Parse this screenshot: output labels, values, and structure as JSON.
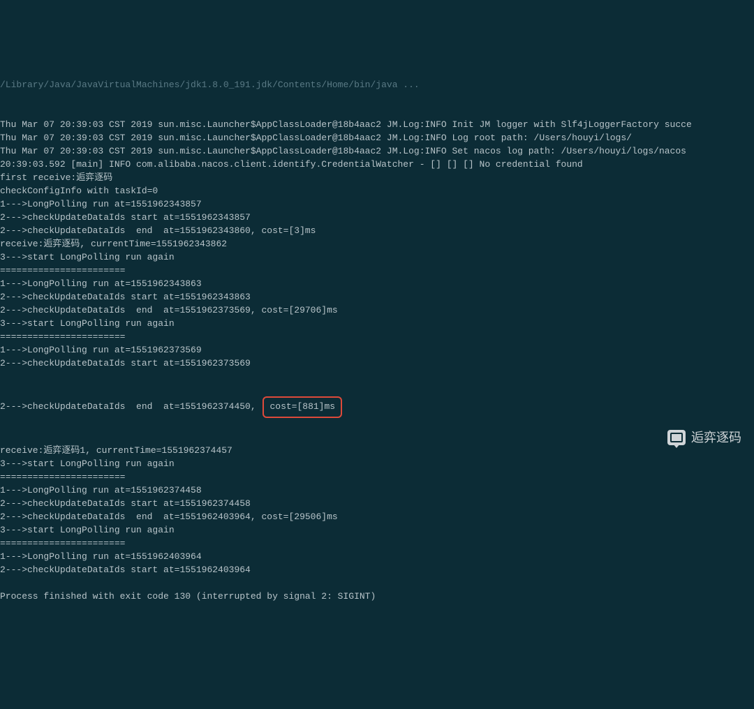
{
  "header": "/Library/Java/JavaVirtualMachines/jdk1.8.0_191.jdk/Contents/Home/bin/java ...",
  "lines": [
    "Thu Mar 07 20:39:03 CST 2019 sun.misc.Launcher$AppClassLoader@18b4aac2 JM.Log:INFO Init JM logger with Slf4jLoggerFactory succe",
    "Thu Mar 07 20:39:03 CST 2019 sun.misc.Launcher$AppClassLoader@18b4aac2 JM.Log:INFO Log root path: /Users/houyi/logs/",
    "Thu Mar 07 20:39:03 CST 2019 sun.misc.Launcher$AppClassLoader@18b4aac2 JM.Log:INFO Set nacos log path: /Users/houyi/logs/nacos",
    "20:39:03.592 [main] INFO com.alibaba.nacos.client.identify.CredentialWatcher - [] [] [] No credential found",
    "first receive:逅弈逐码",
    "checkConfigInfo with taskId=0",
    "1--->LongPolling run at=1551962343857",
    "2--->checkUpdateDataIds start at=1551962343857",
    "2--->checkUpdateDataIds  end  at=1551962343860, cost=[3]ms",
    "receive:逅弈逐码, currentTime=1551962343862",
    "3--->start LongPolling run again",
    "=======================",
    "1--->LongPolling run at=1551962343863",
    "2--->checkUpdateDataIds start at=1551962343863",
    "2--->checkUpdateDataIds  end  at=1551962373569, cost=[29706]ms",
    "3--->start LongPolling run again",
    "=======================",
    "1--->LongPolling run at=1551962373569",
    "2--->checkUpdateDataIds start at=1551962373569"
  ],
  "highlighted": {
    "prefix": "2--->checkUpdateDataIds  end  at=1551962374450, ",
    "boxed": "cost=[881]ms"
  },
  "lines_after": [
    "receive:逅弈逐码1, currentTime=1551962374457",
    "3--->start LongPolling run again",
    "=======================",
    "1--->LongPolling run at=1551962374458",
    "2--->checkUpdateDataIds start at=1551962374458",
    "2--->checkUpdateDataIds  end  at=1551962403964, cost=[29506]ms",
    "3--->start LongPolling run again",
    "=======================",
    "1--->LongPolling run at=1551962403964",
    "2--->checkUpdateDataIds start at=1551962403964",
    "",
    "Process finished with exit code 130 (interrupted by signal 2: SIGINT)"
  ],
  "watermark_text": "逅弈逐码"
}
